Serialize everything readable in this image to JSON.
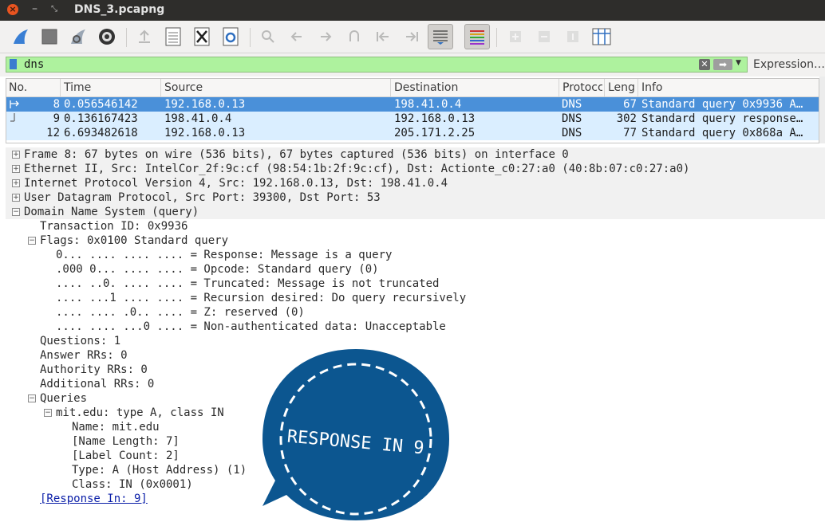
{
  "window": {
    "title": "DNS_3.pcapng"
  },
  "colors": {
    "selected_row": "#4a90d9",
    "dns_row": "#daeeff",
    "filter_valid": "#aef29e",
    "sticker": "#0c5690"
  },
  "toolbar": {
    "icons": [
      "start-capture-icon",
      "stop-capture-icon",
      "restart-capture-icon",
      "capture-options-icon",
      "open-file-icon",
      "save-file-icon",
      "close-file-icon",
      "reload-file-icon",
      "find-packet-icon",
      "go-back-icon",
      "go-forward-icon",
      "go-to-packet-icon",
      "go-first-icon",
      "go-last-icon",
      "autoscroll-icon",
      "colorize-icon",
      "zoom-in-icon",
      "zoom-out-icon",
      "normal-size-icon",
      "resize-columns-icon"
    ]
  },
  "filter": {
    "value": "dns",
    "expression_label": "Expression…"
  },
  "packet_list": {
    "columns": [
      "No.",
      "Time",
      "Source",
      "Destination",
      "Protocc",
      "Leng",
      "Info"
    ],
    "rows": [
      {
        "no": "8",
        "time": "0.056546142",
        "source": "192.168.0.13",
        "destination": "198.41.0.4",
        "protocol": "DNS",
        "length": "67",
        "info": "Standard query 0x9936 A…"
      },
      {
        "no": "9",
        "time": "0.136167423",
        "source": "198.41.0.4",
        "destination": "192.168.0.13",
        "protocol": "DNS",
        "length": "302",
        "info": "Standard query response…"
      },
      {
        "no": "12",
        "time": "6.693482618",
        "source": "192.168.0.13",
        "destination": "205.171.2.25",
        "protocol": "DNS",
        "length": "77",
        "info": "Standard query 0x868a A…"
      }
    ]
  },
  "details": {
    "frame": "Frame 8: 67 bytes on wire (536 bits), 67 bytes captured (536 bits) on interface 0",
    "ethernet": "Ethernet II, Src: IntelCor_2f:9c:cf (98:54:1b:2f:9c:cf), Dst: Actionte_c0:27:a0 (40:8b:07:c0:27:a0)",
    "ip": "Internet Protocol Version 4, Src: 192.168.0.13, Dst: 198.41.0.4",
    "udp": "User Datagram Protocol, Src Port: 39300, Dst Port: 53",
    "dns": "Domain Name System (query)",
    "transaction_id": "Transaction ID: 0x9936",
    "flags": "Flags: 0x0100 Standard query",
    "flag_lines": [
      "0... .... .... .... = Response: Message is a query",
      ".000 0... .... .... = Opcode: Standard query (0)",
      ".... ..0. .... .... = Truncated: Message is not truncated",
      ".... ...1 .... .... = Recursion desired: Do query recursively",
      ".... .... .0.. .... = Z: reserved (0)",
      ".... .... ...0 .... = Non-authenticated data: Unacceptable"
    ],
    "questions": "Questions: 1",
    "answer_rrs": "Answer RRs: 0",
    "authority_rrs": "Authority RRs: 0",
    "additional_rrs": "Additional RRs: 0",
    "queries": "Queries",
    "query": "mit.edu: type A, class IN",
    "query_fields": [
      "Name: mit.edu",
      "[Name Length: 7]",
      "[Label Count: 2]",
      "Type: A (Host Address) (1)",
      "Class: IN (0x0001)"
    ],
    "response_in": "[Response In: 9]"
  },
  "sticker": {
    "text": "RESPONSE IN 9"
  }
}
